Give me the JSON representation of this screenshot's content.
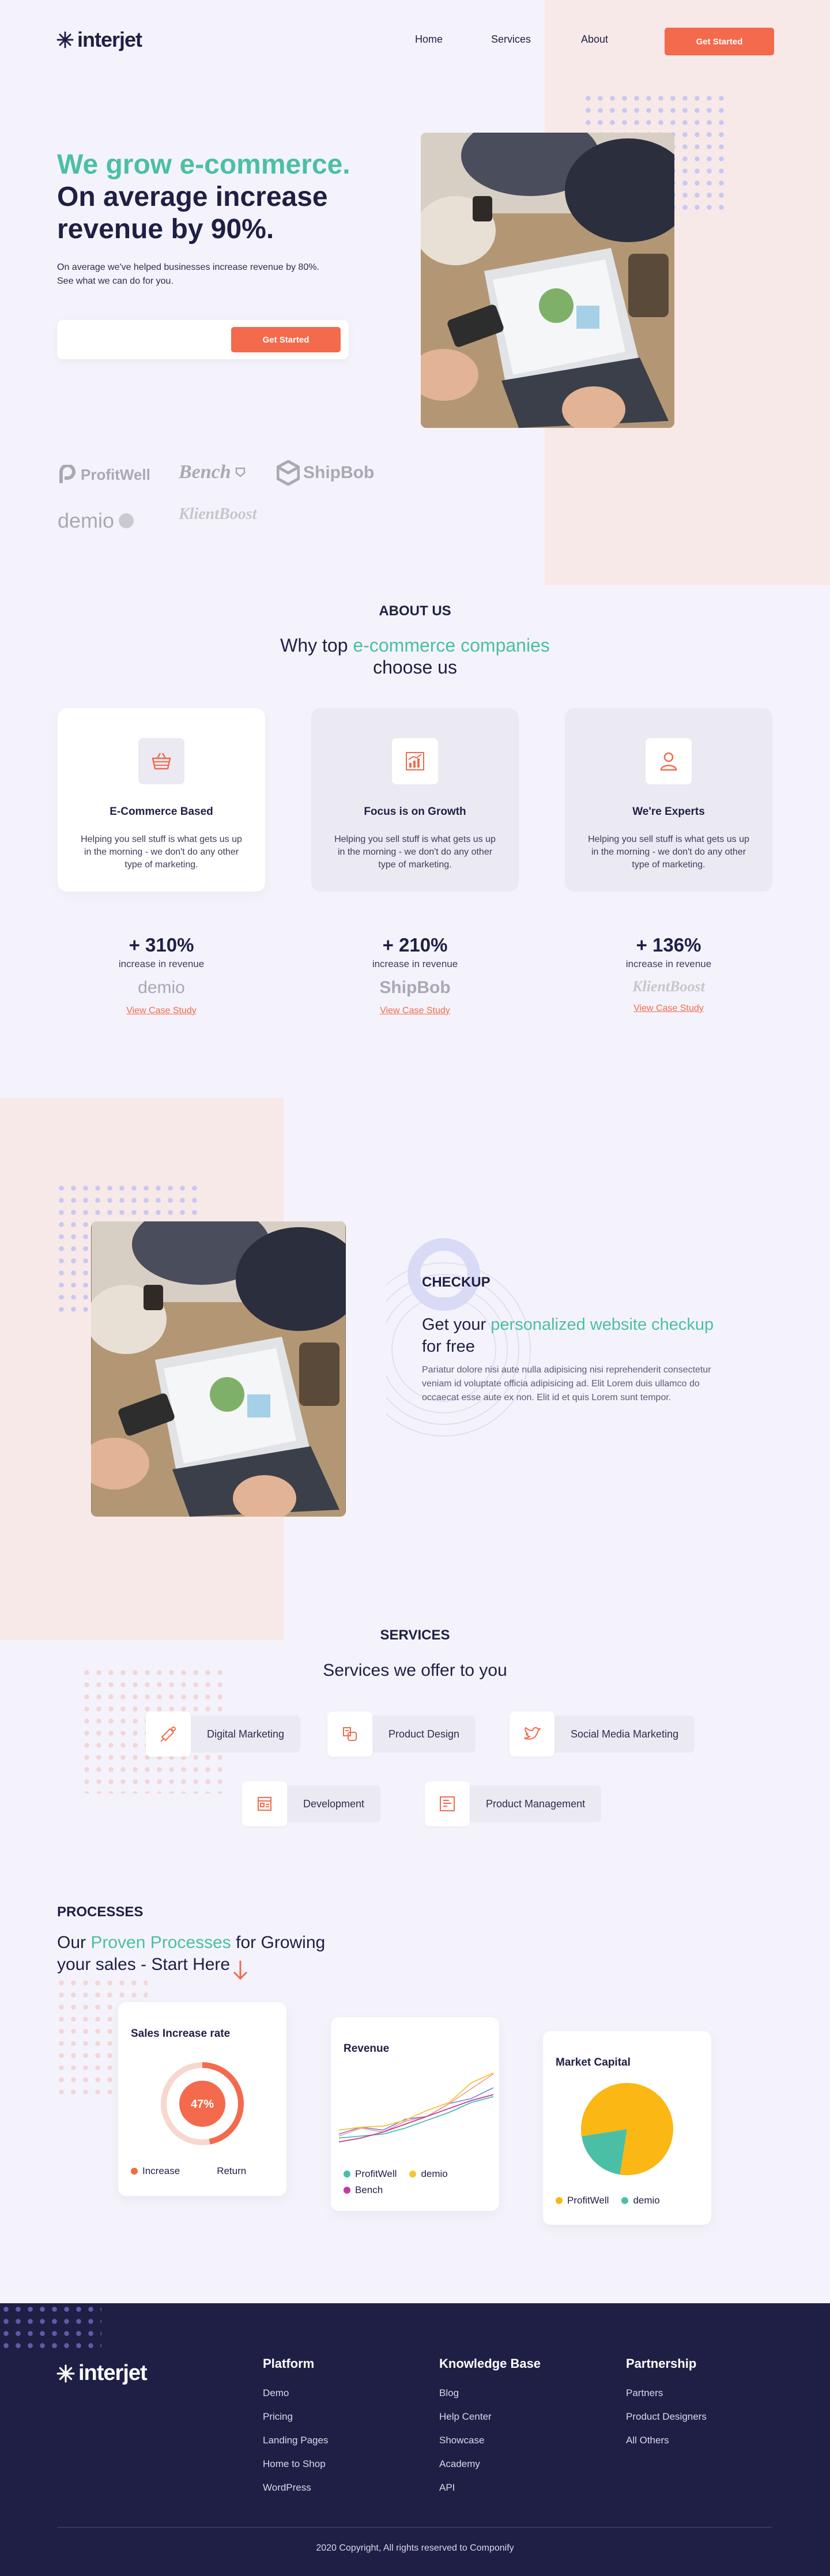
{
  "brand": {
    "name": "interjet"
  },
  "nav": {
    "items": [
      "Home",
      "Services",
      "About"
    ],
    "cta": "Get Started"
  },
  "hero": {
    "headline_accent": "We grow e-commerce.",
    "headline_line2": "On average increase",
    "headline_line3": "revenue by 90%.",
    "sub_line1": "On average we've helped businesses increase revenue by 80%.",
    "sub_line2": "See what we can do for you.",
    "input_placeholder": "",
    "cta": "Get Started"
  },
  "partners": [
    "ProfitWell",
    "Bench",
    "ShipBob",
    "demio",
    "KlientBoost"
  ],
  "about": {
    "label": "ABOUT US",
    "title_pre": "Why top ",
    "title_accent": "e-commerce companies",
    "title_post": "choose us",
    "cards": [
      {
        "title": "E-Commerce Based",
        "text": "Helping you sell stuff is what gets us up in the morning - we don't do any other type of marketing.",
        "icon": "basket-icon"
      },
      {
        "title": "Focus is on Growth",
        "text": "Helping you sell stuff is what gets us up in the morning - we don't do any other type of marketing.",
        "icon": "growth-chart-icon"
      },
      {
        "title": "We're Experts",
        "text": "Helping you sell stuff is what gets us up in the morning - we don't do any other type of marketing.",
        "icon": "user-icon"
      }
    ],
    "stats": [
      {
        "value": "+ 310%",
        "label": "increase in revenue",
        "brand": "demio",
        "link": "View Case Study"
      },
      {
        "value": "+ 210%",
        "label": "increase in revenue",
        "brand": "ShipBob",
        "link": "View Case Study"
      },
      {
        "value": "+ 136%",
        "label": "increase in revenue",
        "brand": "KlientBoost",
        "link": "View Case Study"
      }
    ]
  },
  "checkup": {
    "label": "CHECKUP",
    "title_pre": "Get your ",
    "title_accent": "personalized website checkup",
    "title_post": "for free",
    "body": "Pariatur dolore nisi aute nulla adipisicing nisi reprehenderit consectetur veniam id voluptate officia adipisicing ad. Elit Lorem duis ullamco do occaecat esse aute ex non. Elit id et quis Lorem sunt tempor."
  },
  "services": {
    "label": "SERVICES",
    "title": "Services we offer to you",
    "items": [
      {
        "label": "Digital Marketing",
        "icon": "megaphone-icon"
      },
      {
        "label": "Product Design",
        "icon": "design-tools-icon"
      },
      {
        "label": "Social Media Marketing",
        "icon": "twitter-icon"
      },
      {
        "label": "Development",
        "icon": "code-icon"
      },
      {
        "label": "Product Management",
        "icon": "board-icon"
      }
    ]
  },
  "processes": {
    "label": "PROCESSES",
    "title_pre": "Our ",
    "title_accent": "Proven Processes",
    "title_post": " for Growing",
    "title_line2": "your sales - Start Here"
  },
  "chart_data": [
    {
      "type": "pie",
      "title": "Sales Increase rate",
      "center_label": "47%",
      "categories": [
        "Increase",
        "Return"
      ],
      "values": [
        47,
        53
      ],
      "colors": [
        "#f36a4c",
        "#f8d7cf"
      ]
    },
    {
      "type": "line",
      "title": "Revenue",
      "x": [
        0,
        1,
        2,
        3,
        4,
        5,
        6,
        7
      ],
      "series": [
        {
          "name": "ProfitWell",
          "values": [
            12,
            14,
            16,
            22,
            30,
            38,
            48,
            54
          ],
          "color": "#4bbfa5"
        },
        {
          "name": "demio",
          "values": [
            20,
            23,
            24,
            30,
            40,
            48,
            68,
            78
          ],
          "color": "#f7c433"
        },
        {
          "name": "Bench",
          "values": [
            8,
            12,
            18,
            26,
            34,
            42,
            50,
            56
          ],
          "color": "#c43a9a"
        }
      ],
      "extra_series_colors": [
        "#6b74f0",
        "#f3958c"
      ],
      "legend": "bottom"
    },
    {
      "type": "pie",
      "title": "Market Capital",
      "categories": [
        "ProfitWell",
        "demio"
      ],
      "values": [
        20,
        80
      ],
      "colors": [
        "#4bbfa5",
        "#fbb713"
      ]
    }
  ],
  "footer": {
    "columns": [
      {
        "title": "Platform",
        "links": [
          "Demo",
          "Pricing",
          "Landing Pages",
          "Home to Shop",
          "WordPress"
        ]
      },
      {
        "title": "Knowledge Base",
        "links": [
          "Blog",
          "Help Center",
          "Showcase",
          "Academy",
          "API"
        ]
      },
      {
        "title": "Partnership",
        "links": [
          "Partners",
          "Product Designers",
          "All Others"
        ]
      }
    ],
    "copyright": "2020 Copyright, All rights reserved to Componify"
  },
  "colors": {
    "accent": "#4bbfa5",
    "cta": "#f36a4c",
    "navy": "#1f1f45",
    "blush": "#f8e9e9",
    "footer_bg": "#1f1f45"
  }
}
